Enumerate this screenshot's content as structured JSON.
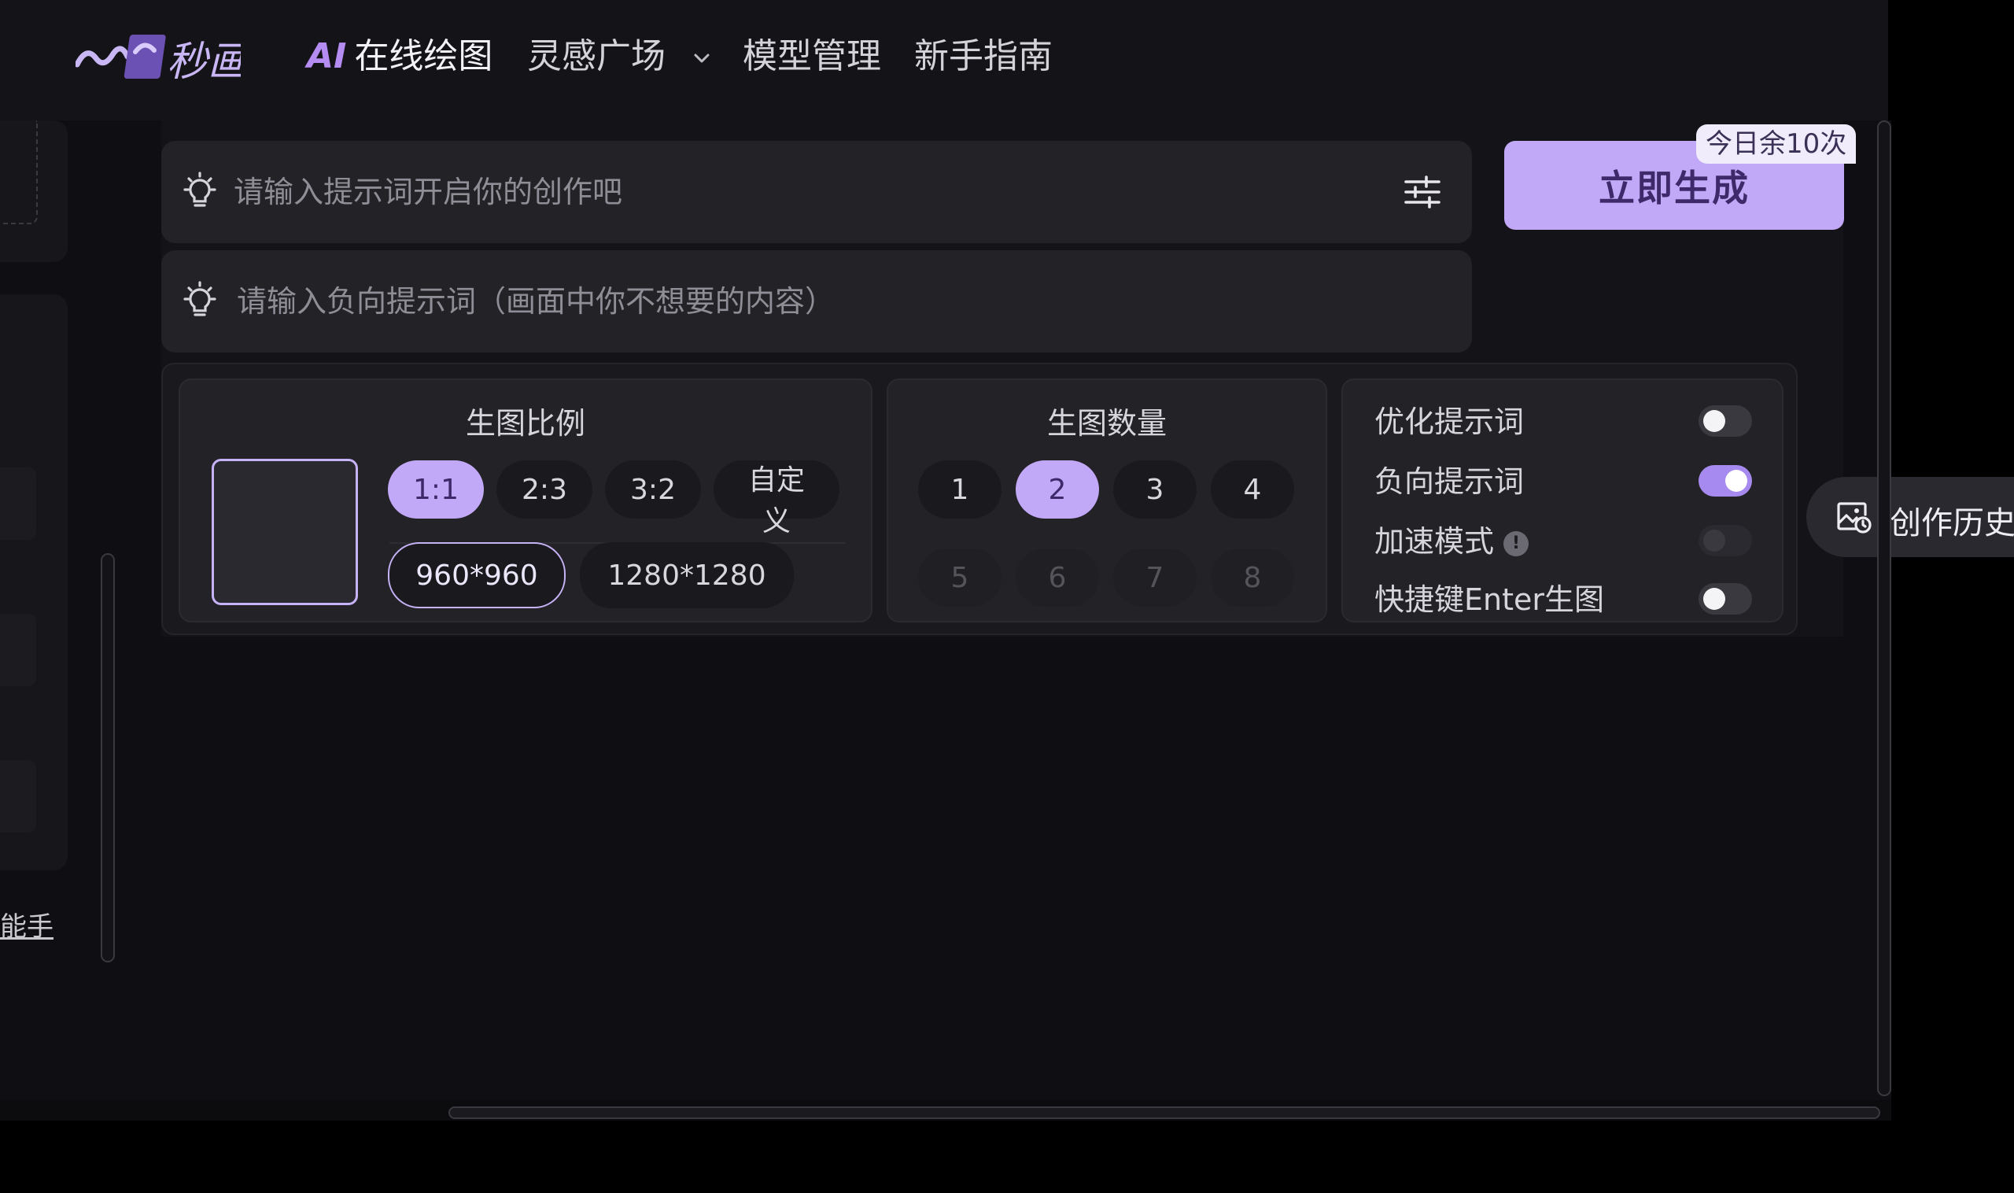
{
  "brand": {
    "name": "秒画"
  },
  "nav": {
    "ai_label": "AI",
    "items": [
      {
        "label": "在线绘图",
        "active": true
      },
      {
        "label": "灵感广场",
        "has_dropdown": true
      },
      {
        "label": "模型管理"
      },
      {
        "label": "新手指南"
      }
    ]
  },
  "left_panel": {
    "link_text": "能手"
  },
  "prompt": {
    "placeholder": "请输入提示词开启你的创作吧",
    "value": ""
  },
  "negative_prompt": {
    "placeholder": "请输入负向提示词（画面中你不想要的内容）",
    "value": ""
  },
  "generate": {
    "label": "立即生成",
    "quota": "今日余10次"
  },
  "ratio": {
    "title": "生图比例",
    "options": [
      {
        "label": "1:1",
        "selected": true
      },
      {
        "label": "2:3",
        "selected": false
      },
      {
        "label": "3:2",
        "selected": false
      },
      {
        "label": "自定义",
        "selected": false
      }
    ],
    "sizes": [
      {
        "label": "960*960",
        "selected": true
      },
      {
        "label": "1280*1280",
        "selected": false
      }
    ]
  },
  "count": {
    "title": "生图数量",
    "options": [
      {
        "label": "1",
        "selected": false,
        "disabled": false
      },
      {
        "label": "2",
        "selected": true,
        "disabled": false
      },
      {
        "label": "3",
        "selected": false,
        "disabled": false
      },
      {
        "label": "4",
        "selected": false,
        "disabled": false
      },
      {
        "label": "5",
        "selected": false,
        "disabled": true
      },
      {
        "label": "6",
        "selected": false,
        "disabled": true
      },
      {
        "label": "7",
        "selected": false,
        "disabled": true
      },
      {
        "label": "8",
        "selected": false,
        "disabled": true
      }
    ]
  },
  "options": [
    {
      "label": "优化提示词",
      "state": "off"
    },
    {
      "label": "负向提示词",
      "state": "on"
    },
    {
      "label": "加速模式",
      "state": "disabled",
      "info": "!"
    },
    {
      "label": "快捷键Enter生图",
      "state": "off"
    }
  ],
  "history": {
    "label": "创作历史"
  },
  "colors": {
    "accent": "#c2a9f7",
    "accent_text": "#3e2a6a",
    "toggle_on": "#a68af0",
    "brand_purple": "#b58cf2",
    "background": "#0f0e12",
    "panel": "#232227"
  }
}
